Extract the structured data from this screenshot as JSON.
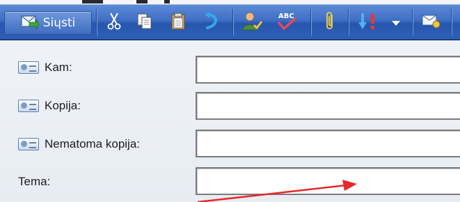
{
  "toolbar": {
    "send_label": "Siųsti",
    "icons": [
      "send-icon",
      "cut-icon",
      "copy-icon",
      "paste-icon",
      "undo-icon",
      "check-names-icon",
      "spelling-icon",
      "attach-icon",
      "priority-icon",
      "dropdown-arrow-icon",
      "message-options-icon"
    ]
  },
  "fields": {
    "to_label": "Kam:",
    "cc_label": "Kopija:",
    "bcc_label": "Nematoma kopija:",
    "subject_label": "Tema:",
    "to_value": "",
    "cc_value": "",
    "bcc_value": "",
    "subject_value": ""
  },
  "colors": {
    "toolbar": "#3e6fc6",
    "annotation_arrow": "#e8262b"
  }
}
